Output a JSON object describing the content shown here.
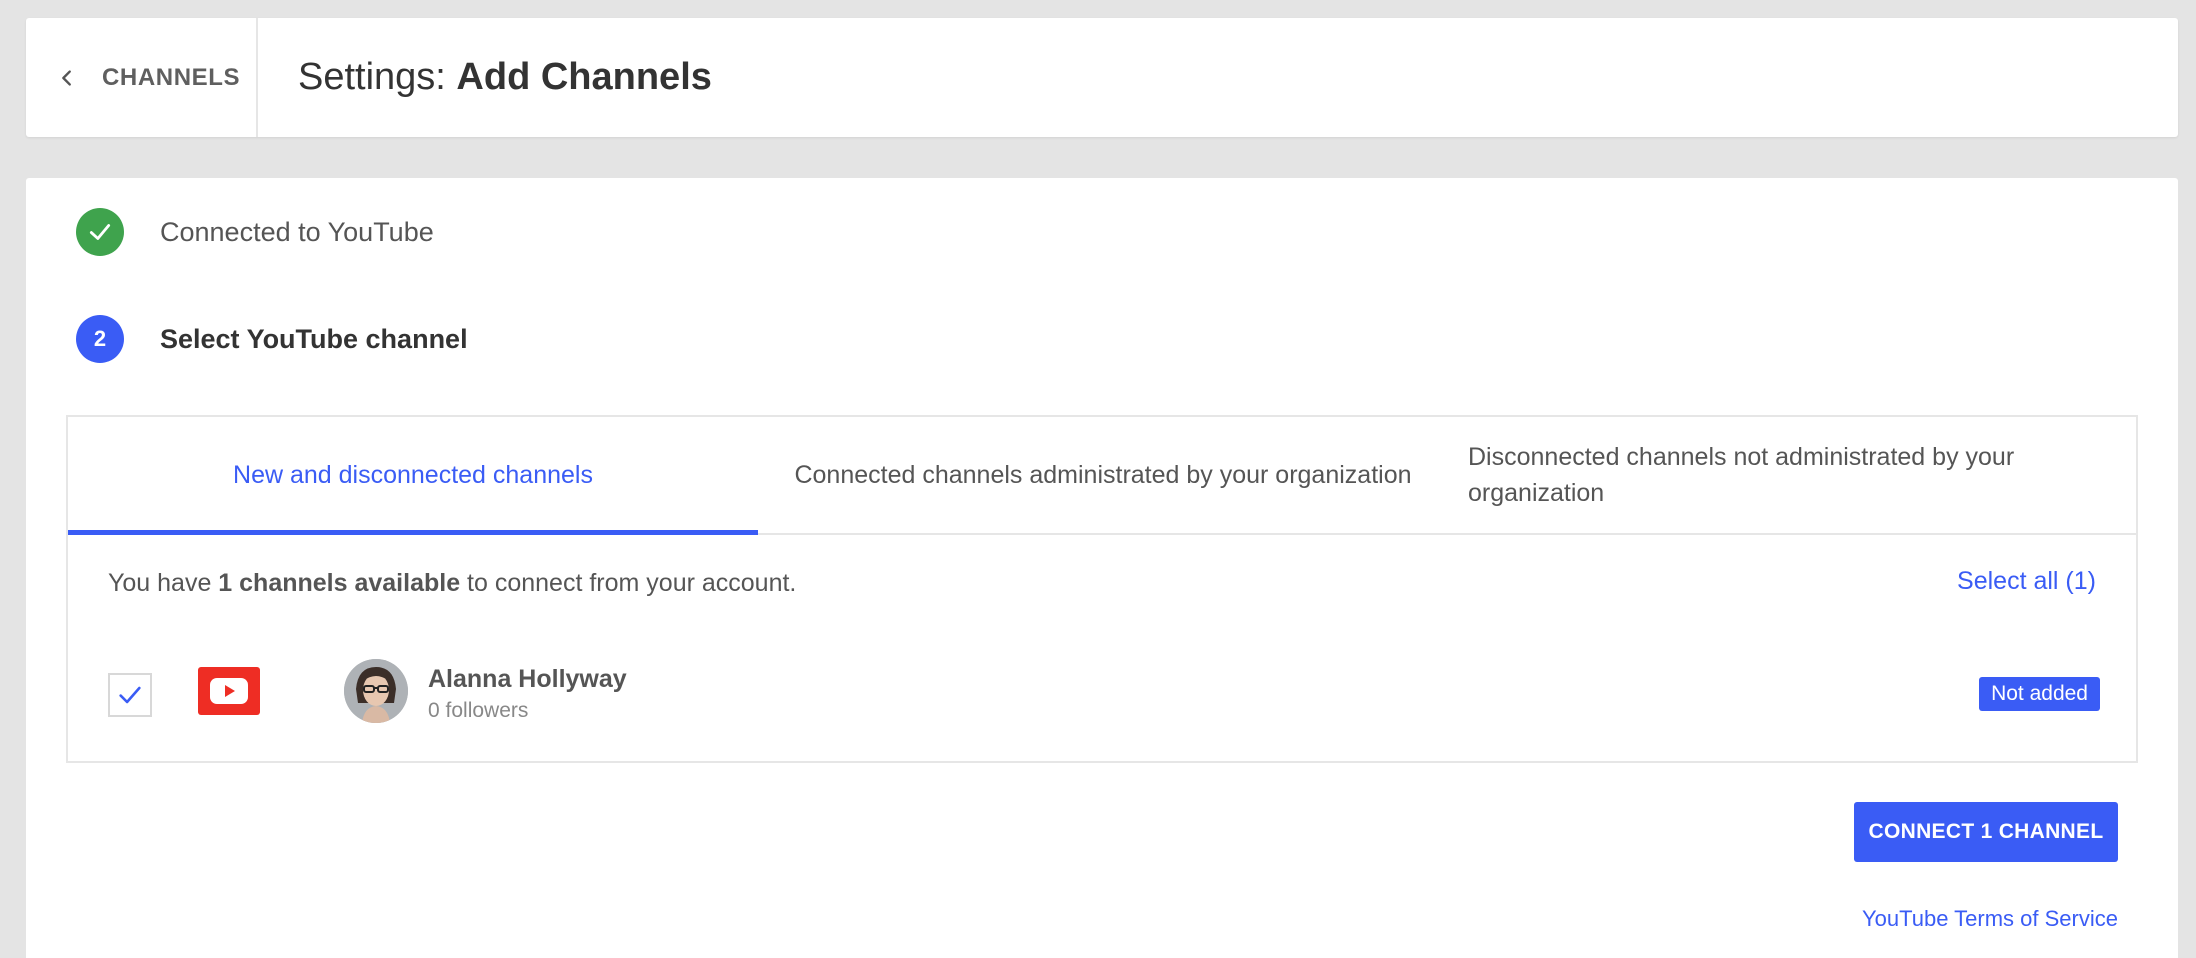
{
  "header": {
    "back_label": "CHANNELS",
    "title_prefix": "Settings: ",
    "title_main": "Add Channels"
  },
  "steps": [
    {
      "label": "Connected to YouTube",
      "state": "done",
      "icon": "check-icon"
    },
    {
      "number": "2",
      "label": "Select YouTube channel",
      "state": "active"
    }
  ],
  "tabs": [
    {
      "label": "New and disconnected channels",
      "active": true
    },
    {
      "label": "Connected channels administrated by your organization",
      "active": false
    },
    {
      "label": "Disconnected channels not administrated by your organization",
      "active": false
    }
  ],
  "available": {
    "prefix": "You have ",
    "count_text": "1 channels available",
    "suffix": " to connect from your account."
  },
  "select_all_label": "Select all (1)",
  "channels": [
    {
      "name": "Alanna Hollyway",
      "followers": "0 followers",
      "status": "Not added",
      "checked": true,
      "platform_icon": "youtube-icon"
    }
  ],
  "connect_button_label": "CONNECT 1 CHANNEL",
  "tos_label": "YouTube Terms of Service",
  "colors": {
    "accent": "#3a5cf5",
    "success": "#3fa34d",
    "youtube": "#ee2d24",
    "background": "#e4e4e4"
  }
}
